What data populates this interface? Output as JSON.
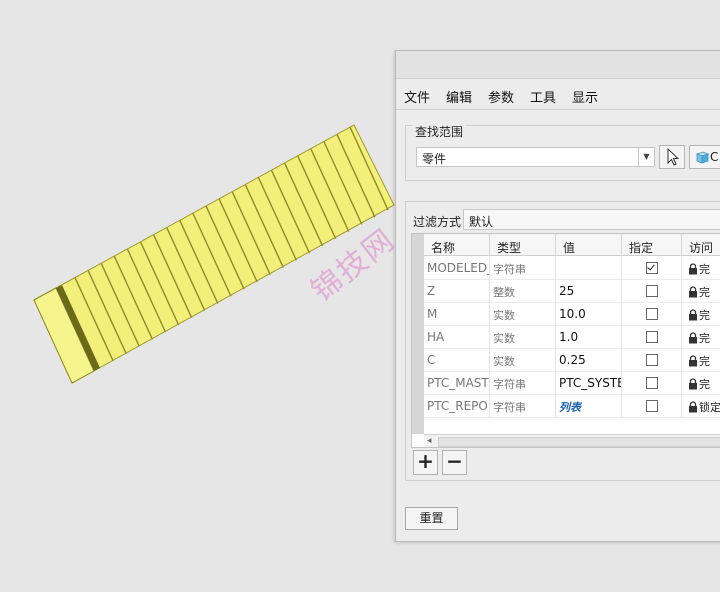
{
  "watermark": "锦技网",
  "menu": [
    "文件",
    "编辑",
    "参数",
    "工具",
    "显示"
  ],
  "lookin": {
    "legend": "查找范围",
    "selected": "零件",
    "part_button_label": "C"
  },
  "filter": {
    "label": "过滤方式",
    "value": "默认"
  },
  "table": {
    "headers": [
      "名称",
      "类型",
      "值",
      "指定",
      "访问"
    ],
    "rows": [
      {
        "name": "MODELED_",
        "type": "字符串",
        "value": "",
        "designated": true,
        "access": "完"
      },
      {
        "name": "Z",
        "type": "整数",
        "value": "25",
        "designated": false,
        "access": "完"
      },
      {
        "name": "M",
        "type": "实数",
        "value": "10.0",
        "designated": false,
        "access": "完"
      },
      {
        "name": "HA",
        "type": "实数",
        "value": "1.0",
        "designated": false,
        "access": "完"
      },
      {
        "name": "C",
        "type": "实数",
        "value": "0.25",
        "designated": false,
        "access": "完"
      },
      {
        "name": "PTC_MAST",
        "type": "字符串",
        "value": "PTC_SYSTE",
        "designated": false,
        "access": "完"
      },
      {
        "name": "PTC_REPOI",
        "type": "字符串",
        "value": "列表",
        "designated": false,
        "access": "锁定"
      }
    ]
  },
  "buttons": {
    "add": "+",
    "remove": "−",
    "reset": "重置"
  },
  "colors": {
    "gear_face": "#f2f07a",
    "gear_shadow": "#c9c74a",
    "link_blue": "#1a5fb4"
  }
}
